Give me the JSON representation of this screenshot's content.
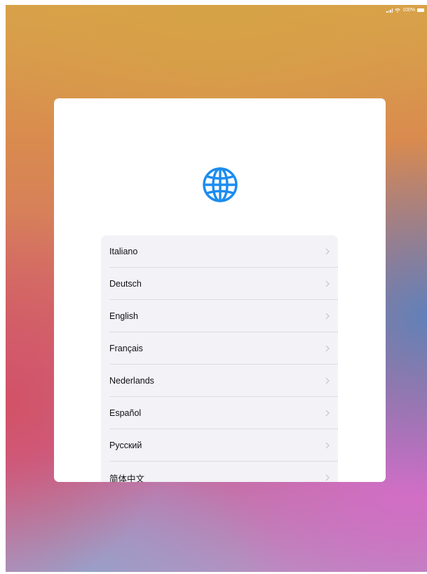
{
  "status_bar": {
    "battery_text": "100%"
  },
  "colors": {
    "accent": "#1c8cf0",
    "list_background": "#f2f2f7",
    "chevron": "#c4c4c9"
  },
  "icons": {
    "header": "globe-icon",
    "row_disclosure": "chevron-right-icon"
  },
  "language_list": {
    "items": [
      {
        "label": "Italiano"
      },
      {
        "label": "Deutsch"
      },
      {
        "label": "English"
      },
      {
        "label": "Français"
      },
      {
        "label": "Nederlands"
      },
      {
        "label": "Español"
      },
      {
        "label": "Русский"
      },
      {
        "label": "简体中文"
      }
    ]
  }
}
